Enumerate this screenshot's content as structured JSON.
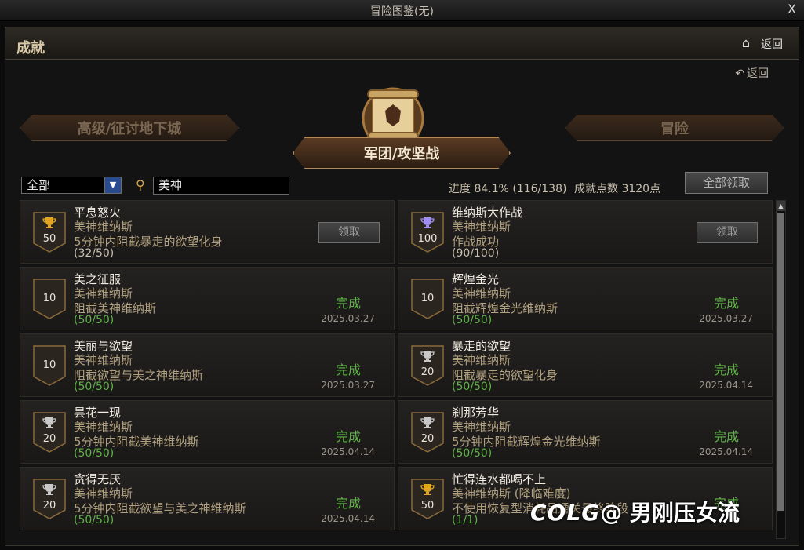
{
  "window": {
    "title": "冒险图鉴(无)",
    "close_label": "X"
  },
  "header": {
    "title": "成就",
    "back_label": "返回"
  },
  "sub_back_label": "返回",
  "tabs": {
    "left": "高级/征讨地下城",
    "center": "军团/攻坚战",
    "right": "冒险"
  },
  "filter": {
    "selected": "全部"
  },
  "search": {
    "value": "美神"
  },
  "summary": {
    "progress": "进度 84.1% (116/138)",
    "points": "成就点数 3120点",
    "claim_all": "全部领取"
  },
  "cards": [
    {
      "title": "平息怒火",
      "category": "美神维纳斯",
      "desc": "5分钟内阻截暴走的欲望化身",
      "progress": "(32/50)",
      "points": "50",
      "cup": "gold",
      "done": false,
      "action": "领取"
    },
    {
      "title": "维纳斯大作战",
      "category": "美神维纳斯",
      "desc": "作战成功",
      "progress": "(90/100)",
      "points": "100",
      "cup": "purple",
      "done": false,
      "action": "领取"
    },
    {
      "title": "美之征服",
      "category": "美神维纳斯",
      "desc": "阻截美神维纳斯",
      "progress": "(50/50)",
      "points": "10",
      "cup": "none",
      "done": true,
      "status": "完成",
      "date": "2025.03.27"
    },
    {
      "title": "辉煌金光",
      "category": "美神维纳斯",
      "desc": "阻截辉煌金光维纳斯",
      "progress": "(50/50)",
      "points": "10",
      "cup": "none",
      "done": true,
      "status": "完成",
      "date": "2025.03.27"
    },
    {
      "title": "美丽与欲望",
      "category": "美神维纳斯",
      "desc": "阻截欲望与美之神维纳斯",
      "progress": "(50/50)",
      "points": "10",
      "cup": "none",
      "done": true,
      "status": "完成",
      "date": "2025.03.27"
    },
    {
      "title": "暴走的欲望",
      "category": "美神维纳斯",
      "desc": "阻截暴走的欲望化身",
      "progress": "(50/50)",
      "points": "20",
      "cup": "silver",
      "done": true,
      "status": "完成",
      "date": "2025.04.14"
    },
    {
      "title": "昙花一现",
      "category": "美神维纳斯",
      "desc": "5分钟内阻截美神维纳斯",
      "progress": "(50/50)",
      "points": "20",
      "cup": "silver",
      "done": true,
      "status": "完成",
      "date": "2025.04.14"
    },
    {
      "title": "刹那芳华",
      "category": "美神维纳斯",
      "desc": "5分钟内阻截辉煌金光维纳斯",
      "progress": "(50/50)",
      "points": "20",
      "cup": "silver",
      "done": true,
      "status": "完成",
      "date": "2025.04.14"
    },
    {
      "title": "贪得无厌",
      "category": "美神维纳斯",
      "desc": "5分钟内阻截欲望与美之神维纳斯",
      "progress": "(50/50)",
      "points": "20",
      "cup": "silver",
      "done": true,
      "status": "完成",
      "date": "2025.04.14"
    },
    {
      "title": "忙得连水都喝不上",
      "category": "美神维纳斯 (降临难度)",
      "desc": "不使用恢复型消耗品通关最终阶段",
      "progress": "(1/1)",
      "points": "50",
      "cup": "gold",
      "done": true,
      "status": "完成",
      "date": ""
    }
  ],
  "watermark": {
    "logo": "COLG",
    "text": "@ 男刚压女流"
  },
  "colors": {
    "accent": "#b08a5a",
    "done": "#5fb447",
    "gold_cup": "#e3a622",
    "silver_cup": "#c9c9c9",
    "purple_cup": "#9f8ff0"
  }
}
